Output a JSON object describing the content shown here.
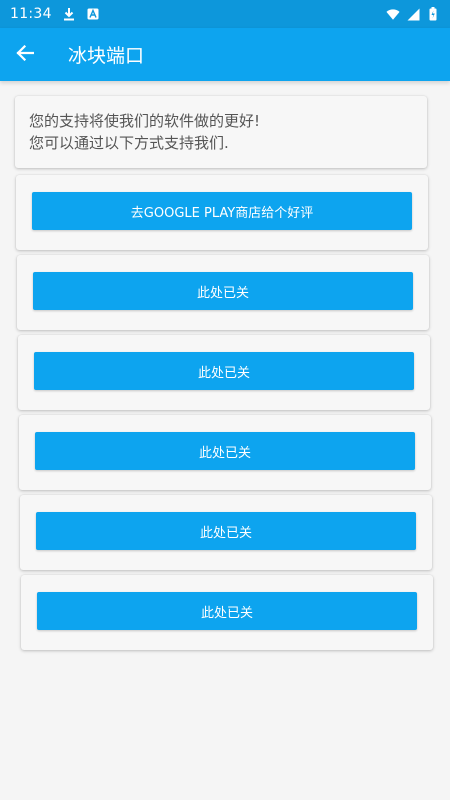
{
  "status_bar": {
    "time": "11:34",
    "icons": [
      "download-icon",
      "notification-a-icon",
      "wifi-icon",
      "cell-signal-icon",
      "battery-icon"
    ]
  },
  "app_bar": {
    "title": "冰块端口",
    "back_icon": "arrow-back-icon"
  },
  "intro": {
    "line1": "您的支持将使我们的软件做的更好!",
    "line2": "您可以通过以下方式支持我们."
  },
  "buttons": [
    {
      "label": "去GOOGLE PLAY商店给个好评"
    },
    {
      "label": "此处已关"
    },
    {
      "label": "此处已关"
    },
    {
      "label": "此处已关"
    },
    {
      "label": "此处已关"
    },
    {
      "label": "此处已关"
    }
  ],
  "colors": {
    "status_bar": "#0d97db",
    "primary": "#0da4ef",
    "background": "#f5f5f5"
  }
}
